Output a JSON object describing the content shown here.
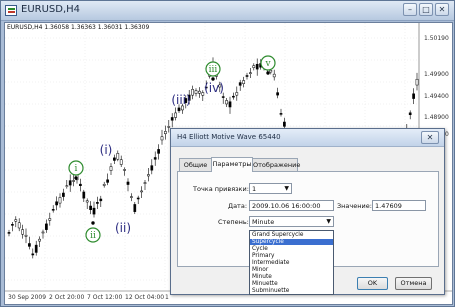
{
  "window": {
    "title": "EURUSD,H4",
    "controls": {
      "minimize": "–",
      "maximize": "□",
      "close": "✕"
    }
  },
  "chart": {
    "symbol_label": "EURUSD,H4  1.36058 1.36363 1.36031 1.36309",
    "price_ticks": [
      "1.50190",
      "1.49900",
      "1.49400",
      "1.48900",
      "1.48400"
    ],
    "time_ticks": [
      "30 Sep 2009",
      "2 Oct 20:00",
      "7 Oct 12:00",
      "12 Oct 04:00",
      "1"
    ],
    "wave_labels": [
      {
        "text": "i",
        "style": "circle-green"
      },
      {
        "text": "ii",
        "style": "circle-green"
      },
      {
        "text": "(i)",
        "style": "paren-navy"
      },
      {
        "text": "(ii)",
        "style": "paren-navy"
      },
      {
        "text": "(iii)",
        "style": "paren-navy"
      },
      {
        "text": "(iv)",
        "style": "paren-navy"
      },
      {
        "text": "iii",
        "style": "circle-green"
      },
      {
        "text": "iv",
        "style": "circle-green"
      },
      {
        "text": "v",
        "style": "circle-green"
      }
    ],
    "colors": {
      "candle": "#000000",
      "label_green": "#2e8b2e",
      "label_navy": "#2b2b80"
    }
  },
  "dialog": {
    "title": "H4 Elliott Motive Wave 65440",
    "close": "✕",
    "tabs": [
      {
        "label": "Общие",
        "active": false
      },
      {
        "label": "Параметры",
        "active": true
      },
      {
        "label": "Отображение",
        "active": false
      }
    ],
    "anchor_label": "Точка привязки:",
    "anchor_value": "1",
    "date_label": "Дата:",
    "date_value": "2009.10.06 16:00:00",
    "value_label": "Значение:",
    "value_value": "1.47609",
    "degree_label": "Степень:",
    "degree_value": "Minute",
    "degree_options": [
      "Grand Supercycle",
      "Supercycle",
      "Cycle",
      "Primary",
      "Intermediate",
      "Minor",
      "Minute",
      "Minuette",
      "Subminuette"
    ],
    "degree_highlighted": "Supercycle",
    "ok_label": "OK",
    "cancel_label": "Отмена",
    "colors": {
      "highlight": "#3b6fd0"
    }
  }
}
